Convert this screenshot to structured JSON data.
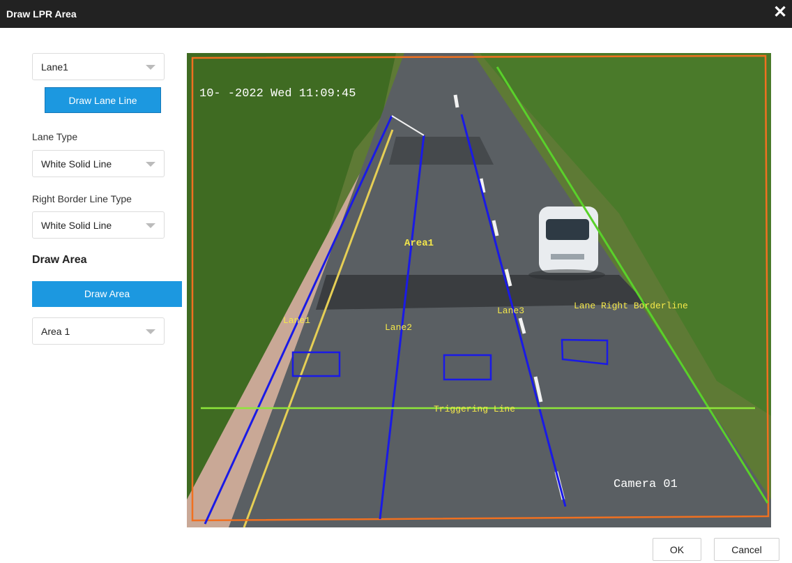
{
  "dialog": {
    "title": "Draw LPR Area",
    "close_icon": "close-icon"
  },
  "sidebar": {
    "lane_select": "Lane1",
    "draw_lane_button": "Draw Lane Line",
    "lane_type_label": "Lane Type",
    "lane_type_select": "White Solid Line",
    "right_border_label": "Right Border Line Type",
    "right_border_select": "White Solid Line",
    "draw_area_heading": "Draw Area",
    "draw_area_button": "Draw Area",
    "area_select": "Area 1"
  },
  "video": {
    "timestamp": "10-  -2022 Wed 11:09:45",
    "camera_name": "Camera 01",
    "overlay_labels": {
      "area": "Area1",
      "lane1": "Lane1",
      "lane2": "Lane2",
      "lane3": "Lane3",
      "right_border": "Lane Right Borderline",
      "triggering": "Triggering Line"
    },
    "colors": {
      "lane_line": "#1a1ae6",
      "triggering_line": "#8ee63a",
      "border_frame": "#f07020",
      "overlay_text": "#f5e84a",
      "right_border_line": "#59d12a"
    }
  },
  "footer": {
    "ok": "OK",
    "cancel": "Cancel"
  }
}
